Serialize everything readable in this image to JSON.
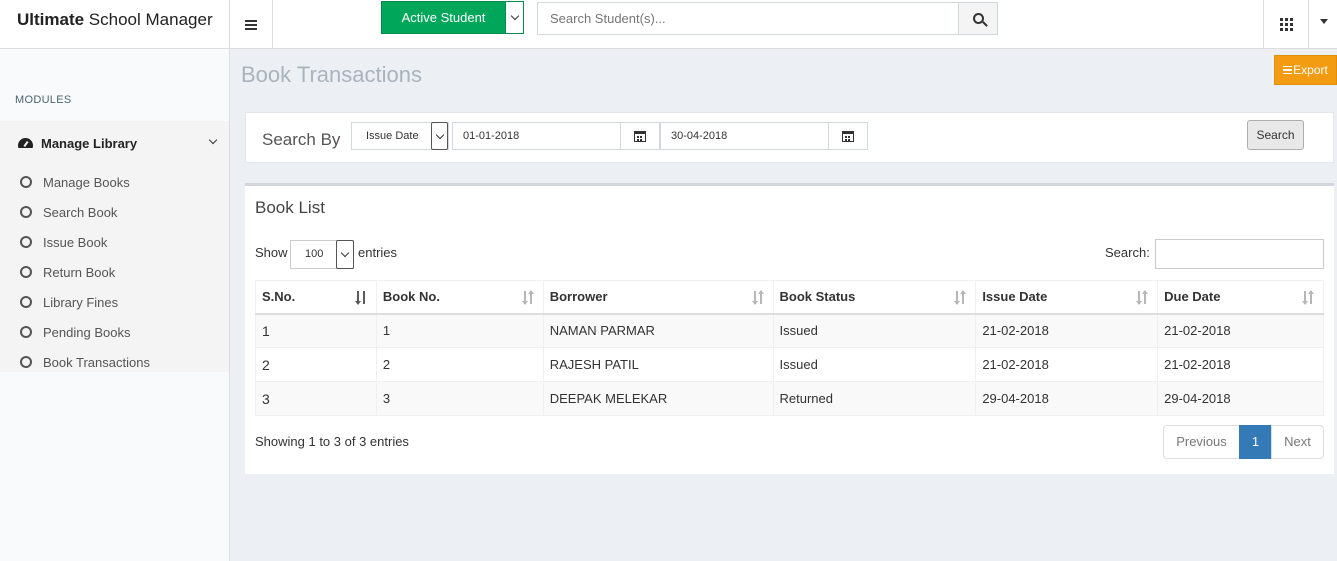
{
  "brand": {
    "bold": "Ultimate",
    "rest": " School Manager"
  },
  "topbar": {
    "active_student_label": "Active Student",
    "student_search_placeholder": "Search Student(s)..."
  },
  "sidebar": {
    "header": "MODULES",
    "parent": {
      "label": "Manage Library",
      "icon": "dashboard-icon"
    },
    "items": [
      {
        "label": "Manage Books"
      },
      {
        "label": "Search Book"
      },
      {
        "label": "Issue Book"
      },
      {
        "label": "Return Book"
      },
      {
        "label": "Library Fines"
      },
      {
        "label": "Pending Books"
      },
      {
        "label": "Book Transactions"
      }
    ]
  },
  "page": {
    "title": "Book Transactions",
    "export_label": "Export"
  },
  "filter": {
    "search_by_label": "Search By",
    "date_type": "Issue Date",
    "from_date": "01-01-2018",
    "to_date": "30-04-2018",
    "search_button": "Search"
  },
  "book_list": {
    "title": "Book List",
    "show_label": "Show",
    "entries_value": "100",
    "entries_label": "entries",
    "search_label": "Search:",
    "columns": [
      "S.No.",
      "Book No.",
      "Borrower",
      "Book Status",
      "Issue Date",
      "Due Date"
    ],
    "rows": [
      [
        "1",
        "1",
        "NAMAN PARMAR",
        "Issued",
        "21-02-2018",
        "21-02-2018"
      ],
      [
        "2",
        "2",
        "RAJESH PATIL",
        "Issued",
        "21-02-2018",
        "21-02-2018"
      ],
      [
        "3",
        "3",
        "DEEPAK MELEKAR",
        "Returned",
        "29-04-2018",
        "29-04-2018"
      ]
    ],
    "info": "Showing 1 to 3 of 3 entries",
    "pagination": {
      "previous": "Previous",
      "current": "1",
      "next": "Next"
    }
  },
  "colors": {
    "active_student_green": "#00a65a",
    "export_orange": "#f39c12",
    "pager_active_blue": "#337ab7"
  }
}
